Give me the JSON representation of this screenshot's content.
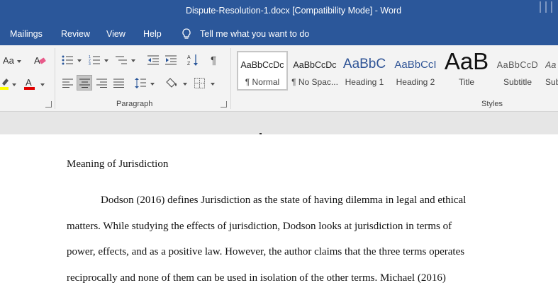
{
  "window": {
    "title": "Dispute-Resolution-1.docx [Compatibility Mode]  -  Word"
  },
  "menu": {
    "items": [
      "Mailings",
      "Review",
      "View",
      "Help"
    ],
    "tell_me": "Tell me what you want to do"
  },
  "ribbon": {
    "groups": {
      "paragraph": "Paragraph",
      "styles": "Styles"
    },
    "font_size_label": "Aa",
    "styles": [
      {
        "preview": "AaBbCcDc",
        "name": "¶ Normal"
      },
      {
        "preview": "AaBbCcDc",
        "name": "¶ No Spac..."
      },
      {
        "preview": "AaBbC",
        "name": "Heading 1"
      },
      {
        "preview": "AaBbCcI",
        "name": "Heading 2"
      },
      {
        "preview": "AaB",
        "name": "Title"
      },
      {
        "preview": "AaBbCcD",
        "name": "Subtitle"
      },
      {
        "preview": "Aa",
        "name": "Sub"
      }
    ],
    "colors": {
      "highlight": "#ffff00",
      "font_color": "#e00000"
    }
  },
  "document": {
    "heading": "Meaning of Jurisdiction",
    "lines": [
      "Dodson (2016) defines Jurisdiction as the state of having dilemma in legal and ethical",
      "matters. While studying the effects of jurisdiction, Dodson looks at jurisdiction in terms of",
      "power, effects, and as a positive law. However, the author claims that the three terms operates",
      "reciprocally and none of them can be used in isolation of the other terms. Michael (2016)"
    ]
  },
  "colors": {
    "title_bar": "#2b579a",
    "ribbon_bg": "#f3f3f3",
    "selected_style_border": "#c6c6c6"
  }
}
